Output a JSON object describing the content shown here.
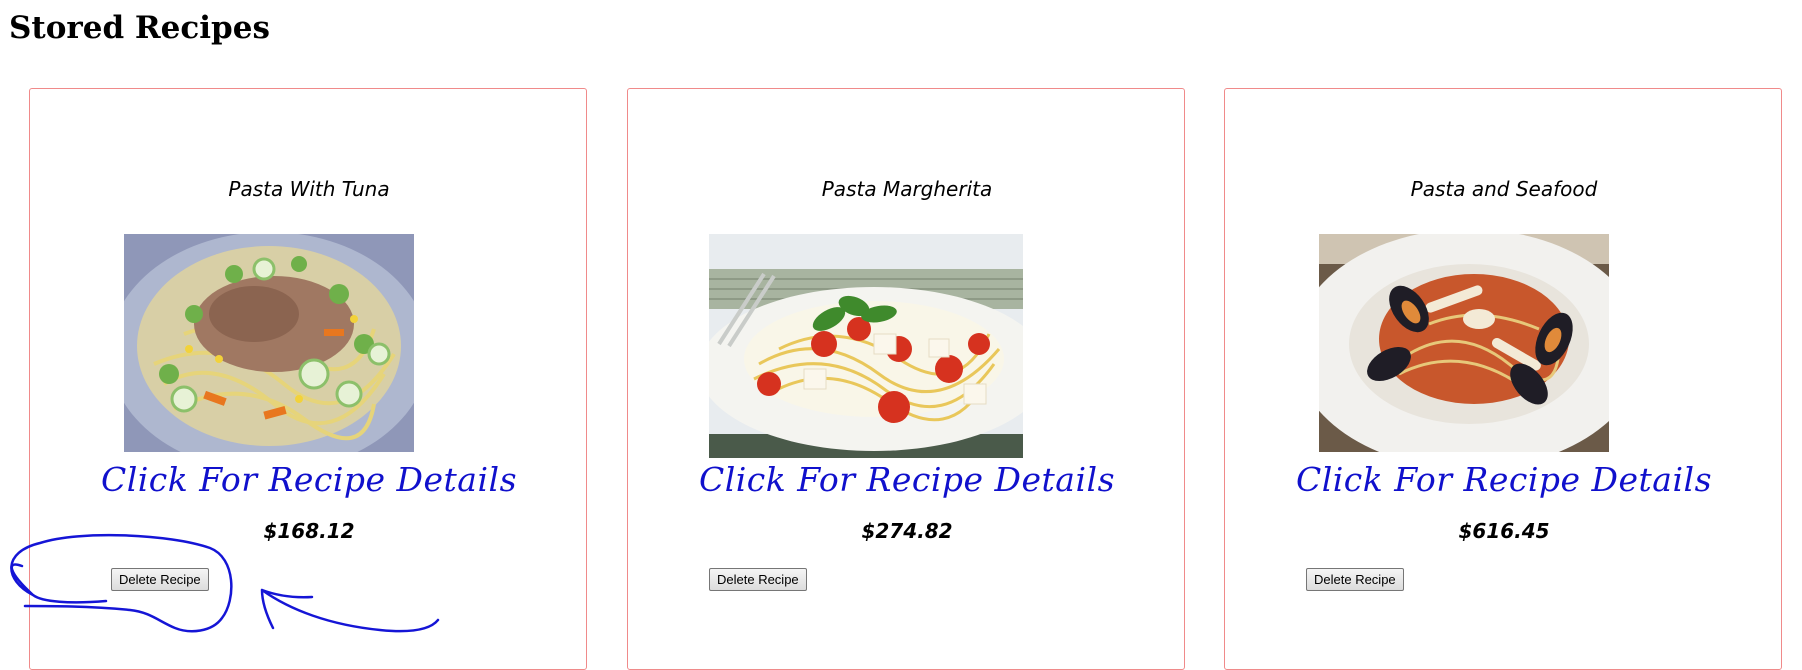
{
  "page": {
    "title": "Stored Recipes"
  },
  "recipes": [
    {
      "name": "Pasta With Tuna",
      "link_label": "Click For Recipe Details",
      "price": "$168.12",
      "delete_label": "Delete Recipe",
      "image_icon": "pasta-with-tuna-photo-icon"
    },
    {
      "name": "Pasta Margherita",
      "link_label": "Click For Recipe Details",
      "price": "$274.82",
      "delete_label": "Delete Recipe",
      "image_icon": "pasta-margherita-photo-icon"
    },
    {
      "name": "Pasta and Seafood",
      "link_label": "Click For Recipe Details",
      "price": "$616.45",
      "delete_label": "Delete Recipe",
      "image_icon": "pasta-and-seafood-photo-icon"
    }
  ],
  "colors": {
    "card_border": "#f08a8a",
    "link": "#1010cc",
    "annotation": "#1515d6"
  },
  "annotation": {
    "icon": "hand-drawn-circle-and-arrow-icon"
  }
}
